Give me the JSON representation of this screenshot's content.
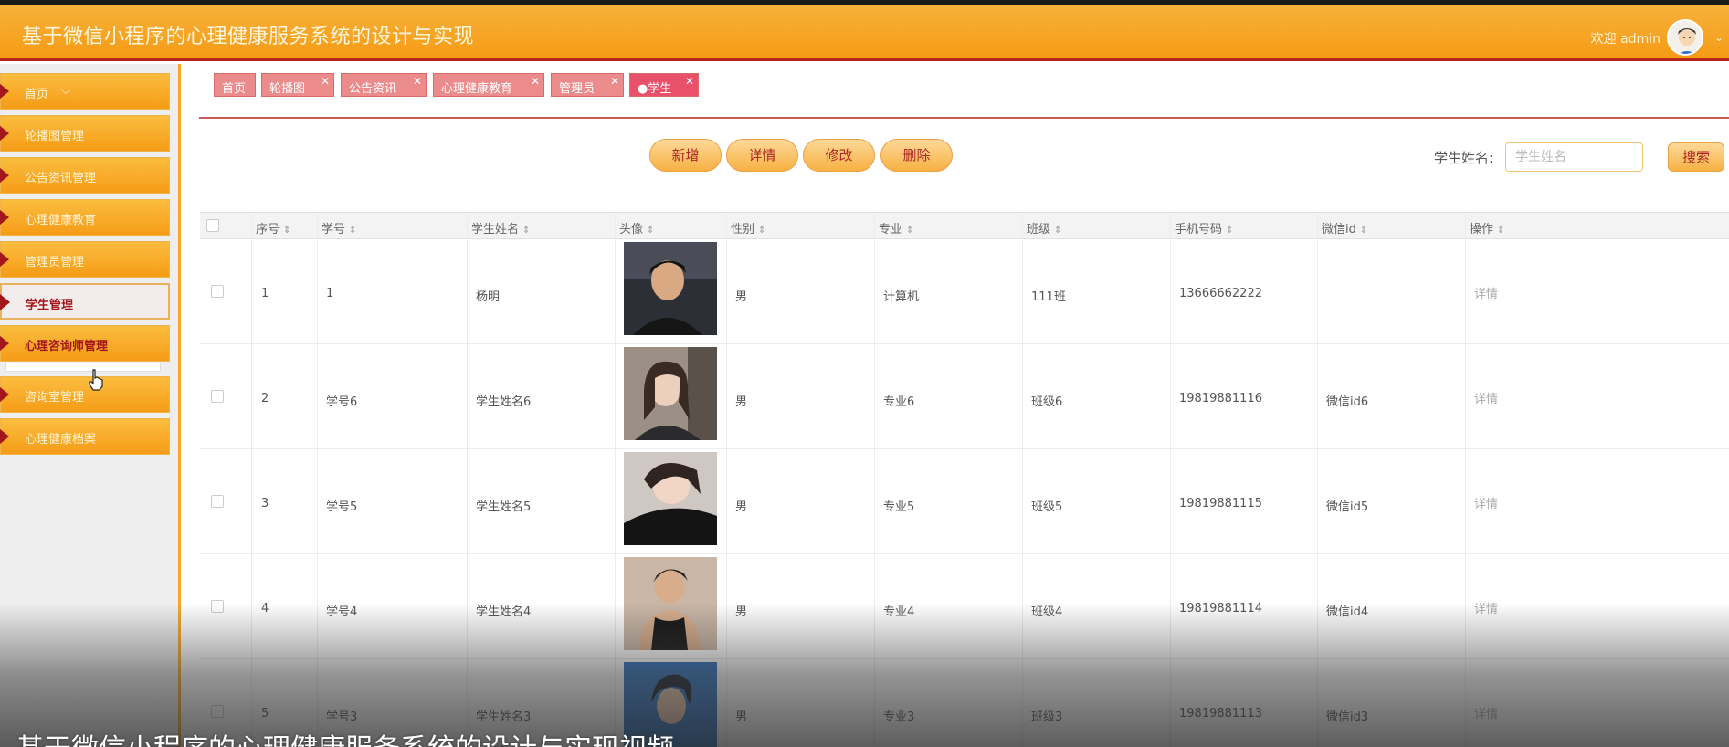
{
  "header": {
    "title": "基于微信小程序的心理健康服务系统的设计与实现",
    "welcome": "欢迎 admin"
  },
  "sidebar": {
    "items": [
      {
        "label": "首页"
      },
      {
        "label": "轮播图管理"
      },
      {
        "label": "公告资讯管理"
      },
      {
        "label": "心理健康教育"
      },
      {
        "label": "管理员管理"
      },
      {
        "label": "学生管理"
      },
      {
        "label": "心理咨询师管理"
      },
      {
        "label": "咨询室管理"
      },
      {
        "label": "心理健康档案"
      }
    ]
  },
  "tabs": [
    {
      "label": "首页"
    },
    {
      "label": "轮播图"
    },
    {
      "label": "公告资讯"
    },
    {
      "label": "心理健康教育"
    },
    {
      "label": "管理员"
    },
    {
      "label": "●学生"
    }
  ],
  "toolbar": {
    "add": "新增",
    "detail": "详情",
    "edit": "修改",
    "delete": "删除",
    "search_label": "学生姓名:",
    "search_placeholder": "学生姓名",
    "search_button": "搜索"
  },
  "table": {
    "headers": [
      "序号",
      "学号",
      "学生姓名",
      "头像",
      "性别",
      "专业",
      "班级",
      "手机号码",
      "微信id",
      "操作"
    ],
    "rows": [
      {
        "index": "1",
        "id": "1",
        "name": "杨明",
        "gender": "男",
        "major": "计算机",
        "class": "111班",
        "phone": "13666662222",
        "wechat": "",
        "op": "详情"
      },
      {
        "index": "2",
        "id": "学号6",
        "name": "学生姓名6",
        "gender": "男",
        "major": "专业6",
        "class": "班级6",
        "phone": "19819881116",
        "wechat": "微信id6",
        "op": "详情"
      },
      {
        "index": "3",
        "id": "学号5",
        "name": "学生姓名5",
        "gender": "男",
        "major": "专业5",
        "class": "班级5",
        "phone": "19819881115",
        "wechat": "微信id5",
        "op": "详情"
      },
      {
        "index": "4",
        "id": "学号4",
        "name": "学生姓名4",
        "gender": "男",
        "major": "专业4",
        "class": "班级4",
        "phone": "19819881114",
        "wechat": "微信id4",
        "op": "详情"
      },
      {
        "index": "5",
        "id": "学号3",
        "name": "学生姓名3",
        "gender": "男",
        "major": "专业3",
        "class": "班级3",
        "phone": "19819881113",
        "wechat": "微信id3",
        "op": "详情"
      }
    ]
  },
  "caption": "基于微信小程序的心理健康服务系统的设计与实现视频",
  "icons": {
    "menu_arrow": "caret-right-icon",
    "sort": "sort-icon",
    "close": "close-icon",
    "avatar": "avatar-icon",
    "cursor": "hand-cursor-icon"
  },
  "colors": {
    "header": "#f59a15",
    "accent": "#a3161b",
    "tab": "#ec8b8b",
    "button_text": "#b02626"
  }
}
